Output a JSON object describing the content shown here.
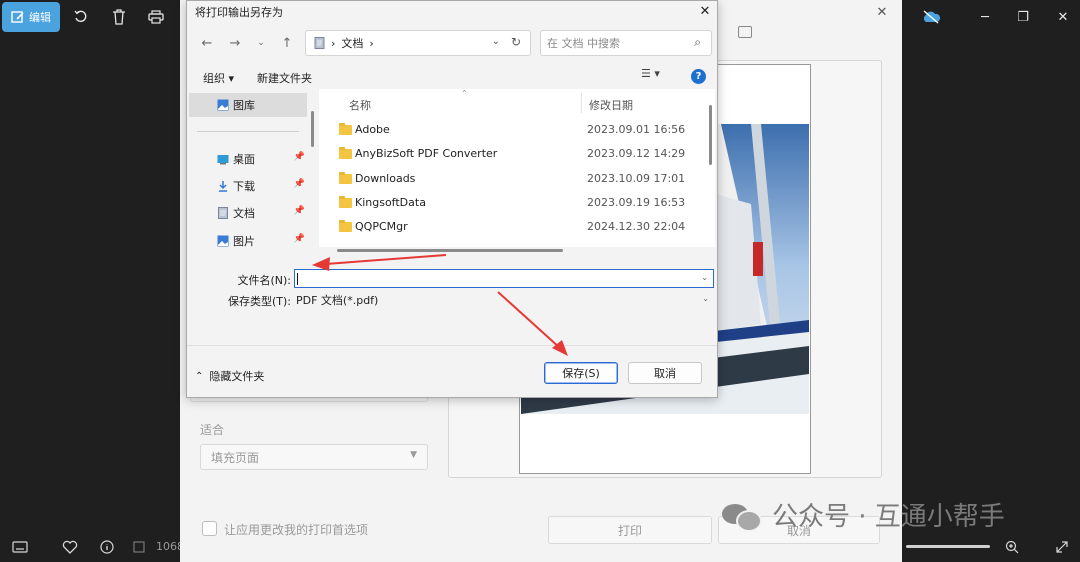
{
  "app": {
    "edit_label": "编辑",
    "edit_icon": "edit-image-icon",
    "toolbar_icons": [
      "rotate-icon",
      "delete-icon",
      "print-icon"
    ],
    "status_size": "1068",
    "bottom_icons": [
      "filmstrip-icon",
      "favorite-icon",
      "info-icon",
      "image-size-icon",
      "zoom-in-icon",
      "fullscreen-icon"
    ]
  },
  "print_window": {
    "fit_label": "适合",
    "fit_value": "填充页面",
    "pref_checkbox_label": "让应用更改我的打印首选项",
    "print_button": "打印",
    "cancel_button": "取消"
  },
  "save_dialog": {
    "title": "将打印输出另存为",
    "address": {
      "root": "文档",
      "separator": "›"
    },
    "search_placeholder": "在 文档 中搜索",
    "toolbar": {
      "organize": "组织 ▾",
      "new_folder": "新建文件夹"
    },
    "sidebar": [
      {
        "label": "图库",
        "icon": "gallery-icon",
        "selected": true,
        "pinned": false
      },
      {
        "label": "桌面",
        "icon": "desktop-icon",
        "selected": false,
        "pinned": true
      },
      {
        "label": "下载",
        "icon": "download-icon",
        "selected": false,
        "pinned": true
      },
      {
        "label": "文档",
        "icon": "document-icon",
        "selected": false,
        "pinned": true
      },
      {
        "label": "图片",
        "icon": "pictures-icon",
        "selected": false,
        "pinned": true
      }
    ],
    "columns": {
      "name": "名称",
      "modified": "修改日期"
    },
    "files": [
      {
        "name": "Adobe",
        "date": "2023.09.01 16:56"
      },
      {
        "name": "AnyBizSoft PDF Converter",
        "date": "2023.09.12 14:29"
      },
      {
        "name": "Downloads",
        "date": "2023.10.09 17:01"
      },
      {
        "name": "KingsoftData",
        "date": "2023.09.19 16:53"
      },
      {
        "name": "QQPCMgr",
        "date": "2024.12.30 22:04"
      }
    ],
    "filename_label": "文件名(N):",
    "filename_value": "",
    "filetype_label": "保存类型(T):",
    "filetype_value": "PDF 文档(*.pdf)",
    "hide_folders": "隐藏文件夹",
    "save_button": "保存(S)",
    "cancel_button": "取消"
  },
  "watermark": {
    "text": "公众号 · 互通小帮手"
  },
  "colors": {
    "accent": "#4aa3df",
    "focus_blue": "#2a6ad1",
    "annotation_red": "#e53935"
  }
}
